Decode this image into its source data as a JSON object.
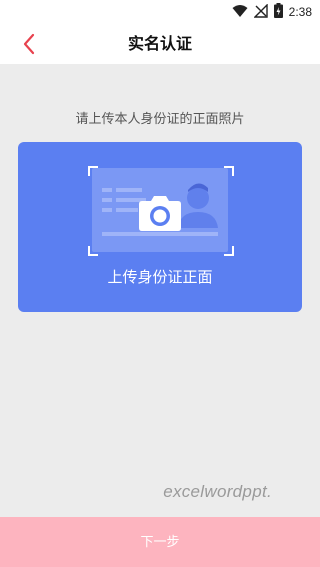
{
  "status_bar": {
    "time": "2:38",
    "icons": [
      "wifi-icon",
      "no-signal-icon",
      "battery-charging-icon"
    ]
  },
  "nav": {
    "title": "实名认证",
    "back_icon": "chevron-left-icon",
    "back_color": "#e8424e"
  },
  "instruction": "请上传本人身份证的正面照片",
  "upload_card": {
    "label": "上传身份证正面",
    "icon": "camera-icon",
    "accent": "#5b7ff1"
  },
  "watermark": "excelwordppt.",
  "footer": {
    "next_label": "下一步",
    "button_color": "#fdb4bf"
  }
}
